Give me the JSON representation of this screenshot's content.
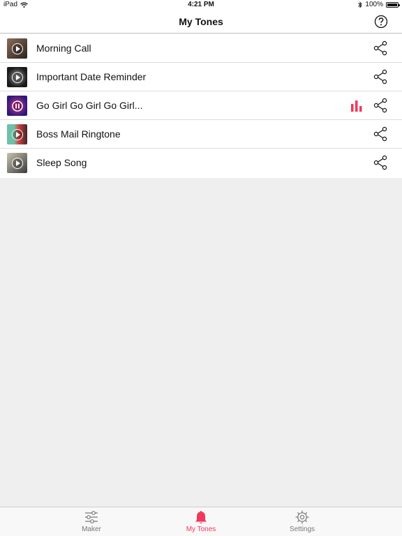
{
  "status": {
    "device": "iPad",
    "time": "4:21 PM",
    "battery": "100%"
  },
  "nav": {
    "title": "My Tones"
  },
  "tones": [
    {
      "name": "Morning Call",
      "thumb_colors": [
        "#8a6d5a",
        "#2a2320"
      ],
      "playing": false
    },
    {
      "name": "Important Date Reminder",
      "thumb_colors": [
        "#9a9a9a",
        "#1a1a1a"
      ],
      "playing": false
    },
    {
      "name": "Go Girl Go Girl Go Girl...",
      "thumb_colors": [
        "#e0308a",
        "#2a1a7a"
      ],
      "playing": true
    },
    {
      "name": "Boss Mail Ringtone",
      "thumb_colors": [
        "#6fc0a8",
        "#d23a3a"
      ],
      "playing": false
    },
    {
      "name": "Sleep Song",
      "thumb_colors": [
        "#c9c4b0",
        "#3a3a3a"
      ],
      "playing": false
    }
  ],
  "tabs": {
    "maker": "Maker",
    "my_tones": "My Tones",
    "settings": "Settings"
  },
  "colors": {
    "accent": "#f2385a",
    "background": "#efefef"
  }
}
